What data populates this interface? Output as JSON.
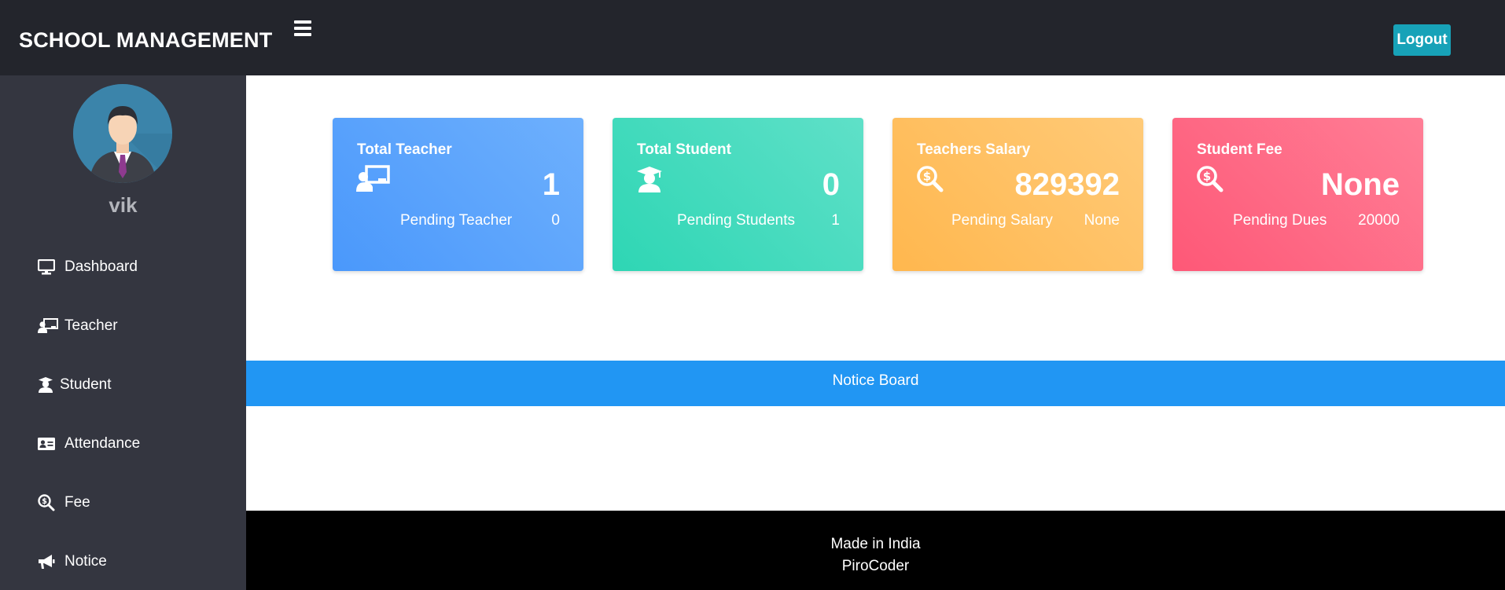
{
  "header": {
    "brand": "SCHOOL MANAGEMENT",
    "logout_label": "Logout"
  },
  "sidebar": {
    "username": "vik",
    "items": [
      {
        "label": "Dashboard",
        "icon": "monitor-icon"
      },
      {
        "label": "Teacher",
        "icon": "chalkboard-teacher-icon"
      },
      {
        "label": "Student",
        "icon": "user-graduate-icon"
      },
      {
        "label": "Attendance",
        "icon": "id-card-icon"
      },
      {
        "label": "Fee",
        "icon": "search-dollar-icon"
      },
      {
        "label": "Notice",
        "icon": "bullhorn-icon"
      }
    ]
  },
  "cards": [
    {
      "title": "Total Teacher",
      "value": "1",
      "sub_label": "Pending Teacher",
      "sub_value": "0",
      "icon": "chalkboard-teacher-icon",
      "color": "#4b9bfc"
    },
    {
      "title": "Total Student",
      "value": "0",
      "sub_label": "Pending Students",
      "sub_value": "1",
      "icon": "user-graduate-icon",
      "color": "#35d4b5"
    },
    {
      "title": "Teachers Salary",
      "value": "829392",
      "sub_label": "Pending Salary",
      "sub_value": "None",
      "icon": "search-dollar-icon",
      "color": "#ffb752"
    },
    {
      "title": "Student Fee",
      "value": "None",
      "sub_label": "Pending Dues",
      "sub_value": "20000",
      "icon": "search-dollar-icon",
      "color": "#fe5a79"
    }
  ],
  "notice": {
    "title": "Notice Board"
  },
  "footer": {
    "line1": "Made in India",
    "line2": "PiroCoder"
  },
  "colors": {
    "topbar": "#23252c",
    "sidebar": "#343640",
    "logout_button": "#17a2b8",
    "notice_bar": "#2196f3",
    "footer": "#000000"
  }
}
